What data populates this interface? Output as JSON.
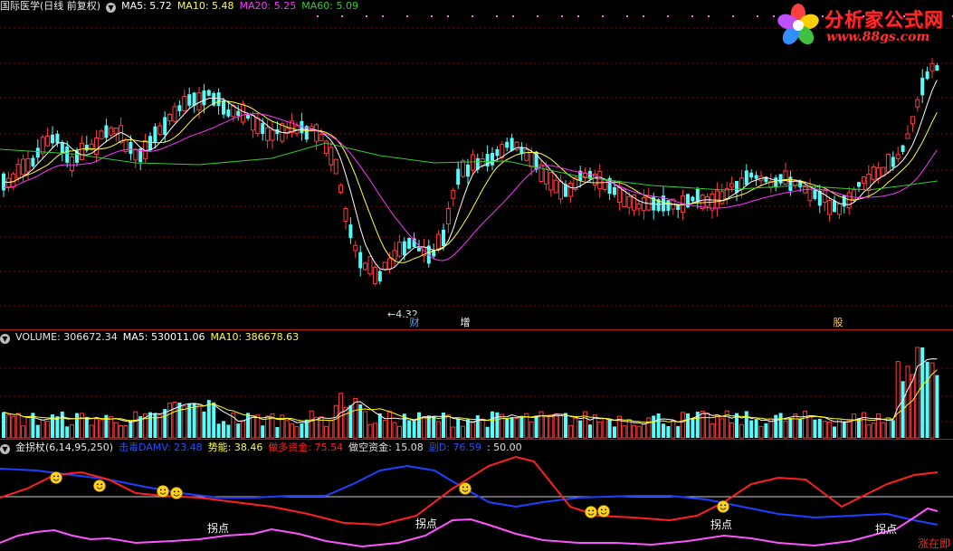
{
  "colors": {
    "up": "#ff3c3c",
    "down": "#54fcfc",
    "ma5": "#ffffff",
    "ma10": "#ffff3c",
    "ma20": "#ff33ff",
    "ma60": "#33cc33",
    "grid": "#8b0000",
    "separator": "#b01818",
    "jc_red": "#ff2020",
    "jc_blue": "#2040ff",
    "jc_pink": "#ff55ff",
    "label_text": "#ffffff",
    "volume_ma5": "#ffffff",
    "volume_ma10": "#ffff00"
  },
  "price_panel": {
    "stock_name": "国际医学(日线 前复权)",
    "ma5_label": "MA5: 5.72",
    "ma10_label": "MA10: 5.48",
    "ma20_label": "MA20: 5.25",
    "ma60_label": "MA60: 5.09",
    "low_marker": "4.32",
    "event_markers": [
      {
        "id": "cai",
        "text": "财",
        "color": "#54a0ff"
      },
      {
        "id": "zeng",
        "text": "增",
        "color": "#ffffff"
      },
      {
        "id": "gu",
        "text": "股",
        "color": "#ffcc66"
      }
    ]
  },
  "volume_panel": {
    "volume_label": "VOLUME: 306672.34",
    "ma5_label": "MA5: 530011.06",
    "ma10_label": "MA10: 386678.63"
  },
  "indicator_panel": {
    "name_label": "金拐杖(6,14,95,250)",
    "items": [
      {
        "text": "击毒DAMV: 23.48",
        "color": "#2050ff"
      },
      {
        "text": "势能: 38.46",
        "color": "#ffff40"
      },
      {
        "text": "做多资金: 75.54",
        "color": "#ff2020"
      },
      {
        "text": "做空资金: 15.08",
        "color": "#e0e0e0"
      },
      {
        "text": "副D: 76.59",
        "color": "#2050ff"
      },
      {
        "text": ": 50.00",
        "color": "#e0e0e0"
      }
    ],
    "turn_label": "拐点",
    "footer_label": "涨在即"
  },
  "logo": {
    "brand": "分析家公式网",
    "url": "www.88gs.com"
  },
  "icons": [
    "collapse-arrow-icon",
    "flower-logo-icon",
    "smiley-icon"
  ]
}
